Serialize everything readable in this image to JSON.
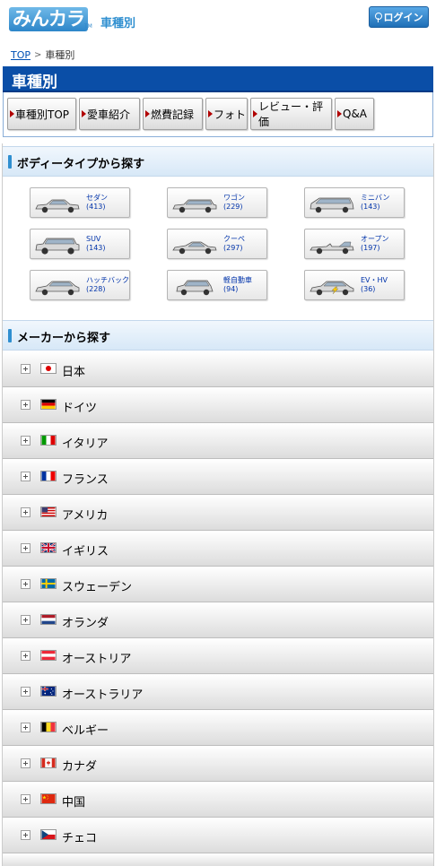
{
  "header": {
    "logo_text": "みんカラ",
    "logo_tm": "TM",
    "section_title": "車種別",
    "login_label": "ログイン"
  },
  "breadcrumb": {
    "items": [
      "TOP",
      "車種別"
    ],
    "separator": ">"
  },
  "page_title": "車種別",
  "tabs": [
    {
      "label": "車種別TOP"
    },
    {
      "label": "愛車紹介"
    },
    {
      "label": "燃費記録"
    },
    {
      "label": "フォト"
    },
    {
      "label": "レビュー・評価"
    },
    {
      "label": "Q&A"
    }
  ],
  "body_type_section": {
    "title": "ボディータイプから探す",
    "types": [
      {
        "name": "セダン",
        "count": "(413)",
        "icon": "sedan-icon"
      },
      {
        "name": "ワゴン",
        "count": "(229)",
        "icon": "wagon-icon"
      },
      {
        "name": "ミニバン",
        "count": "(143)",
        "icon": "minivan-icon"
      },
      {
        "name": "SUV",
        "count": "(143)",
        "icon": "suv-icon"
      },
      {
        "name": "クーペ",
        "count": "(297)",
        "icon": "coupe-icon"
      },
      {
        "name": "オープン",
        "count": "(197)",
        "icon": "open-car-icon"
      },
      {
        "name": "ハッチバック",
        "count": "(228)",
        "icon": "hatchback-icon"
      },
      {
        "name": "軽自動車",
        "count": "(94)",
        "icon": "kei-car-icon"
      },
      {
        "name": "EV・HV",
        "count": "(36)",
        "icon": "ev-hv-icon"
      }
    ]
  },
  "maker_section": {
    "title": "メーカーから探す",
    "countries": [
      {
        "name": "日本",
        "flag": "japan-flag-icon"
      },
      {
        "name": "ドイツ",
        "flag": "germany-flag-icon"
      },
      {
        "name": "イタリア",
        "flag": "italy-flag-icon"
      },
      {
        "name": "フランス",
        "flag": "france-flag-icon"
      },
      {
        "name": "アメリカ",
        "flag": "usa-flag-icon"
      },
      {
        "name": "イギリス",
        "flag": "uk-flag-icon"
      },
      {
        "name": "スウェーデン",
        "flag": "sweden-flag-icon"
      },
      {
        "name": "オランダ",
        "flag": "netherlands-flag-icon"
      },
      {
        "name": "オーストリア",
        "flag": "austria-flag-icon"
      },
      {
        "name": "オーストラリア",
        "flag": "australia-flag-icon"
      },
      {
        "name": "ベルギー",
        "flag": "belgium-flag-icon"
      },
      {
        "name": "カナダ",
        "flag": "canada-flag-icon"
      },
      {
        "name": "中国",
        "flag": "china-flag-icon"
      },
      {
        "name": "チェコ",
        "flag": "czech-flag-icon"
      }
    ]
  },
  "colors": {
    "brand_blue": "#0a4ea7",
    "accent_blue": "#2f8fd0",
    "tab_marker_red": "#b10000",
    "link_blue": "#0050b4"
  }
}
